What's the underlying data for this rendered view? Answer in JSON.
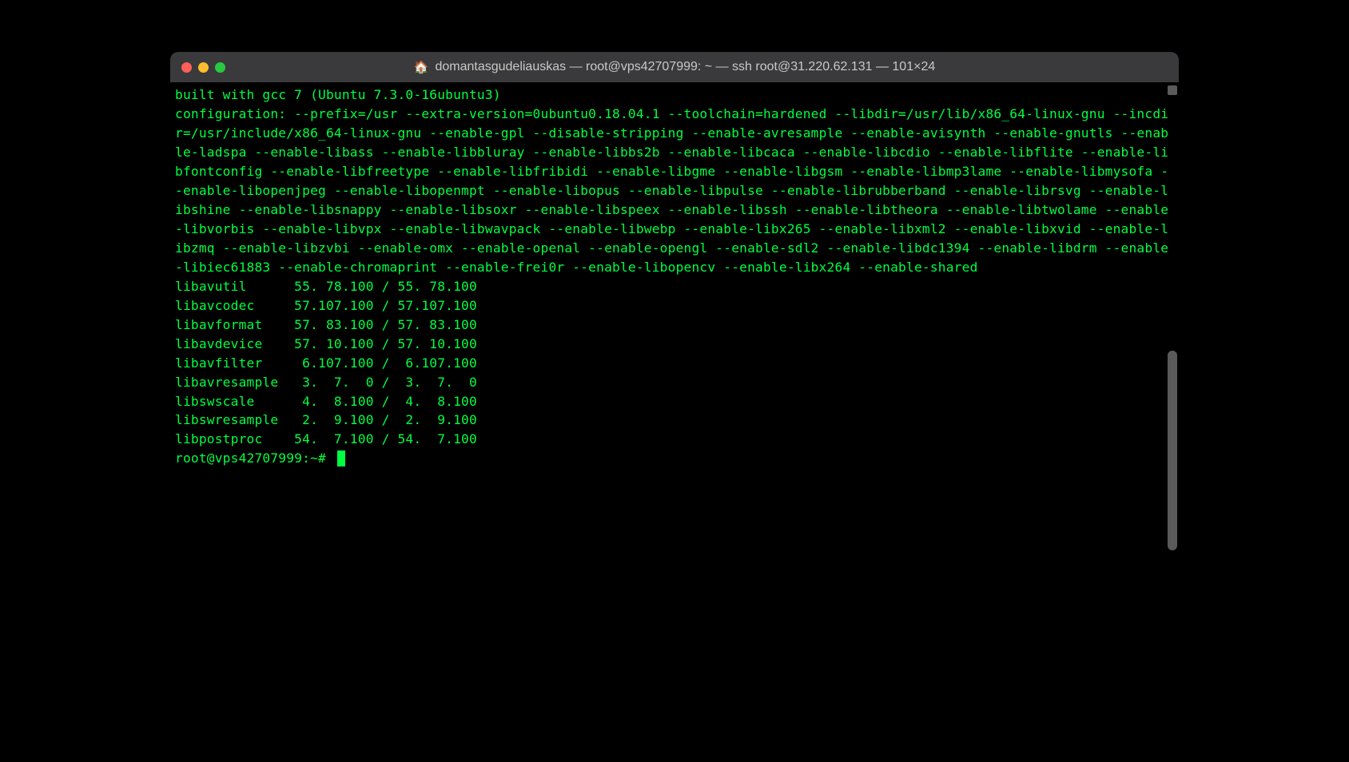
{
  "window": {
    "title": "domantasgudeliauskas — root@vps42707999: ~ — ssh root@31.220.62.131 — 101×24"
  },
  "terminal": {
    "config_block": "built with gcc 7 (Ubuntu 7.3.0-16ubuntu3)\nconfiguration: --prefix=/usr --extra-version=0ubuntu0.18.04.1 --toolchain=hardened --libdir=/usr/lib/x86_64-linux-gnu --incdir=/usr/include/x86_64-linux-gnu --enable-gpl --disable-stripping --enable-avresample --enable-avisynth --enable-gnutls --enable-ladspa --enable-libass --enable-libbluray --enable-libbs2b --enable-libcaca --enable-libcdio --enable-libflite --enable-libfontconfig --enable-libfreetype --enable-libfribidi --enable-libgme --enable-libgsm --enable-libmp3lame --enable-libmysofa --enable-libopenjpeg --enable-libopenmpt --enable-libopus --enable-libpulse --enable-librubberband --enable-librsvg --enable-libshine --enable-libsnappy --enable-libsoxr --enable-libspeex --enable-libssh --enable-libtheora --enable-libtwolame --enable-libvorbis --enable-libvpx --enable-libwavpack --enable-libwebp --enable-libx265 --enable-libxml2 --enable-libxvid --enable-libzmq --enable-libzvbi --enable-omx --enable-openal --enable-opengl --enable-sdl2 --enable-libdc1394 --enable-libdrm --enable-libiec61883 --enable-chromaprint --enable-frei0r --enable-libopencv --enable-libx264 --enable-shared",
    "lib_lines": [
      "libavutil      55. 78.100 / 55. 78.100",
      "libavcodec     57.107.100 / 57.107.100",
      "libavformat    57. 83.100 / 57. 83.100",
      "libavdevice    57. 10.100 / 57. 10.100",
      "libavfilter     6.107.100 /  6.107.100",
      "libavresample   3.  7.  0 /  3.  7.  0",
      "libswscale      4.  8.100 /  4.  8.100",
      "libswresample   2.  9.100 /  2.  9.100",
      "libpostproc    54.  7.100 / 54.  7.100"
    ],
    "prompt": "root@vps42707999:~# "
  }
}
